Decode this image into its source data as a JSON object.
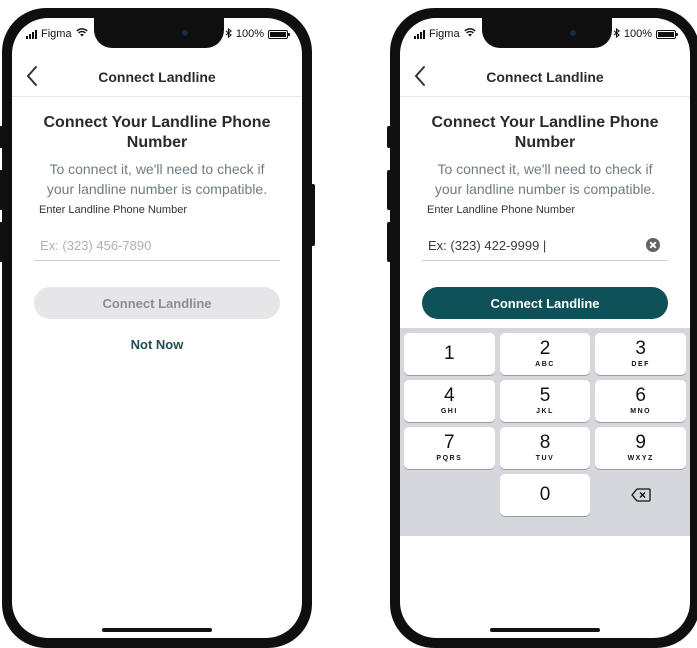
{
  "status_bar": {
    "carrier": "Figma",
    "battery": "100%"
  },
  "screens": [
    {
      "nav_title": "Connect Landline",
      "headline": "Connect Your Landline Phone Number",
      "description": "To connect it, we'll need to check if your landline number is compatible.",
      "field_label": "Enter Landline Phone Number",
      "input_placeholder": "Ex: (323) 456-7890",
      "input_value": "",
      "primary_button": "Connect Landline",
      "primary_button_state": "disabled",
      "secondary_button": "Not Now"
    },
    {
      "nav_title": "Connect Landline",
      "headline": "Connect Your Landline Phone Number",
      "description": "To connect it, we'll need to check if your landline number is compatible.",
      "field_label": "Enter Landline Phone Number",
      "input_value": "Ex: (323) 422-9999 |",
      "primary_button": "Connect Landline",
      "primary_button_state": "active"
    }
  ],
  "keypad": {
    "keys": [
      {
        "num": "1",
        "letters": ""
      },
      {
        "num": "2",
        "letters": "ABC"
      },
      {
        "num": "3",
        "letters": "DEF"
      },
      {
        "num": "4",
        "letters": "GHI"
      },
      {
        "num": "5",
        "letters": "JKL"
      },
      {
        "num": "6",
        "letters": "MNO"
      },
      {
        "num": "7",
        "letters": "PQRS"
      },
      {
        "num": "8",
        "letters": "TUV"
      },
      {
        "num": "9",
        "letters": "WXYZ"
      },
      {
        "num": "0",
        "letters": ""
      }
    ],
    "delete_glyph": "⌫"
  },
  "colors": {
    "accent": "#0e5158",
    "secondary_text": "#1f4d52",
    "disabled_bg": "#e6e6e9",
    "disabled_text": "#8d8d92",
    "muted_text": "#6f7b82",
    "keypad_bg": "#d6d7dc"
  },
  "icons": [
    "signal-icon",
    "wifi-icon",
    "bluetooth-icon",
    "battery-icon",
    "back-chevron-icon",
    "clear-input-icon",
    "backspace-icon"
  ]
}
